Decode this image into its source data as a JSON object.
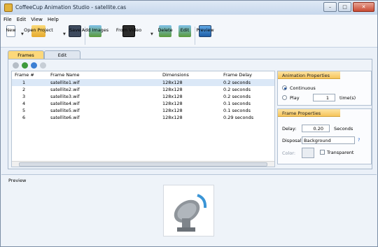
{
  "window": {
    "title": "CoffeeCup Animation Studio - satellite.cas"
  },
  "menu": {
    "items": [
      "File",
      "Edit",
      "View",
      "Help"
    ]
  },
  "toolbar": {
    "new_label": "New",
    "open_label": "Open Project",
    "save_label": "Save",
    "add_images_label": "Add Images",
    "from_video_label": "From Video",
    "delete_label": "Delete",
    "edit_label": "Edit",
    "preview_label": "Preview"
  },
  "tabs": {
    "frames": "Frames",
    "edit": "Edit"
  },
  "table": {
    "headers": {
      "frame": "Frame #",
      "name": "Frame Name",
      "dimensions": "Dimensions",
      "delay": "Frame Delay"
    },
    "rows": [
      {
        "frame": "1",
        "name": "satellite1.wif",
        "dimensions": "128x128",
        "delay": "0.2 seconds"
      },
      {
        "frame": "2",
        "name": "satellite2.wif",
        "dimensions": "128x128",
        "delay": "0.2 seconds"
      },
      {
        "frame": "3",
        "name": "satellite3.wif",
        "dimensions": "128x128",
        "delay": "0.2 seconds"
      },
      {
        "frame": "4",
        "name": "satellite4.wif",
        "dimensions": "128x128",
        "delay": "0.1 seconds"
      },
      {
        "frame": "5",
        "name": "satellite5.wif",
        "dimensions": "128x128",
        "delay": "0.1 seconds"
      },
      {
        "frame": "6",
        "name": "satellite6.wif",
        "dimensions": "128x128",
        "delay": "0.29 seconds"
      }
    ]
  },
  "animation_properties": {
    "title": "Animation Properties",
    "continuous_label": "Continuous",
    "play_label": "Play",
    "play_value": "1",
    "times_label": "time(s)"
  },
  "frame_properties": {
    "title": "Frame Properties",
    "delay_label": "Delay:",
    "delay_value": "0.20",
    "seconds_label": "Seconds",
    "disposal_label": "Disposal:",
    "disposal_value": "Background",
    "color_label": "Color:",
    "transparent_label": "Transparent"
  },
  "preview": {
    "label": "Preview"
  },
  "colors": {
    "accent": "#f6c45a",
    "selection": "#dbe8f7"
  }
}
